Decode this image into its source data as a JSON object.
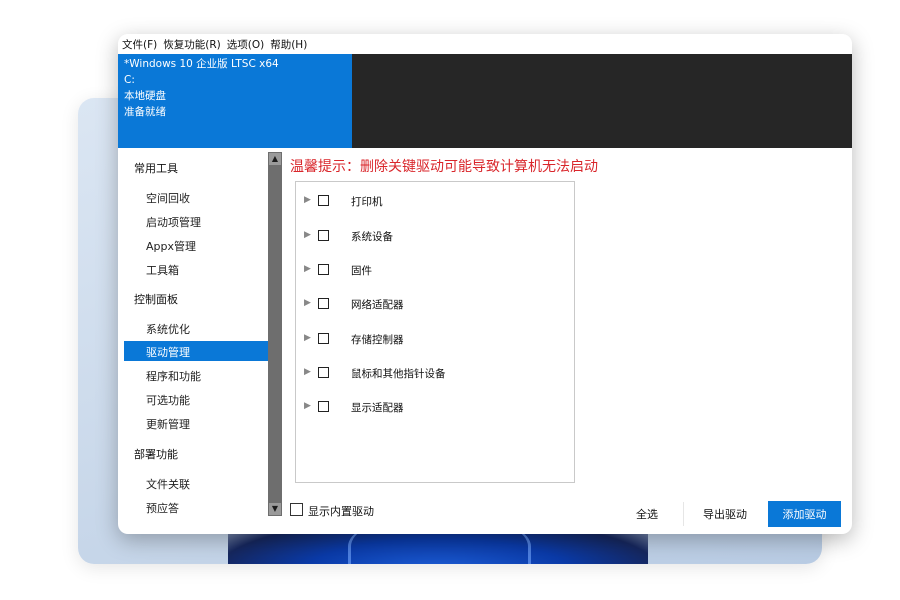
{
  "menubar": {
    "items": [
      "文件(F)",
      "恢复功能(R)",
      "选项(O)",
      "帮助(H)"
    ]
  },
  "info": {
    "image_name": "*Windows 10 企业版 LTSC x64",
    "drive": "C:",
    "disk_type": "本地硬盘",
    "status": "准备就绪"
  },
  "sidebar": {
    "categories": [
      {
        "label": "常用工具",
        "items": [
          "空间回收",
          "启动项管理",
          "Appx管理",
          "工具箱"
        ]
      },
      {
        "label": "控制面板",
        "items": [
          "系统优化",
          "驱动管理",
          "程序和功能",
          "可选功能",
          "更新管理"
        ]
      },
      {
        "label": "部署功能",
        "items": [
          "文件关联",
          "预应答"
        ]
      }
    ],
    "selected": "驱动管理"
  },
  "main": {
    "warning": "温馨提示：删除关键驱动可能导致计算机无法启动",
    "driver_tree": [
      "打印机",
      "系统设备",
      "固件",
      "网络适配器",
      "存储控制器",
      "鼠标和其他指针设备",
      "显示适配器"
    ],
    "show_builtin_label": "显示内置驱动",
    "buttons": {
      "select_all": "全选",
      "export": "导出驱动",
      "add": "添加驱动"
    }
  },
  "colors": {
    "accent": "#0a78d7",
    "warning": "#d9262b",
    "dark_bar": "#262626",
    "scrollbar": "#6e6e6e"
  },
  "icons": {
    "tree_expand": "chevron-right-icon",
    "scroll_up": "triangle-up-icon",
    "scroll_down": "triangle-down-icon"
  }
}
